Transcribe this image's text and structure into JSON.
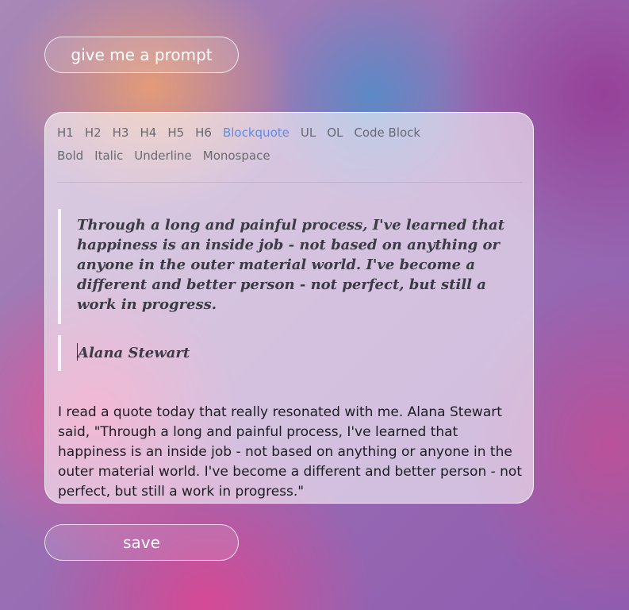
{
  "prompt_button_label": "give me a prompt",
  "save_button_label": "save",
  "toolbar": {
    "row1": [
      "H1",
      "H2",
      "H3",
      "H4",
      "H5",
      "H6",
      "Blockquote",
      "UL",
      "OL",
      "Code Block"
    ],
    "row2": [
      "Bold",
      "Italic",
      "Underline",
      "Monospace"
    ],
    "active": "Blockquote",
    "active_color": "#5b8def"
  },
  "editor": {
    "quote": "Through a long and painful process, I've learned that happiness is an inside job - not based on anything or anyone in the outer material world. I've become a different and better person - not perfect, but still a work in progress.",
    "author": "Alana Stewart",
    "body": "I read a quote today that really resonated with me. Alana Stewart said, \"Through a long and painful process, I've learned that happiness is an inside job - not based on anything or anyone in the outer material world. I've become a different and better person - not perfect, but still a work in progress.\""
  }
}
